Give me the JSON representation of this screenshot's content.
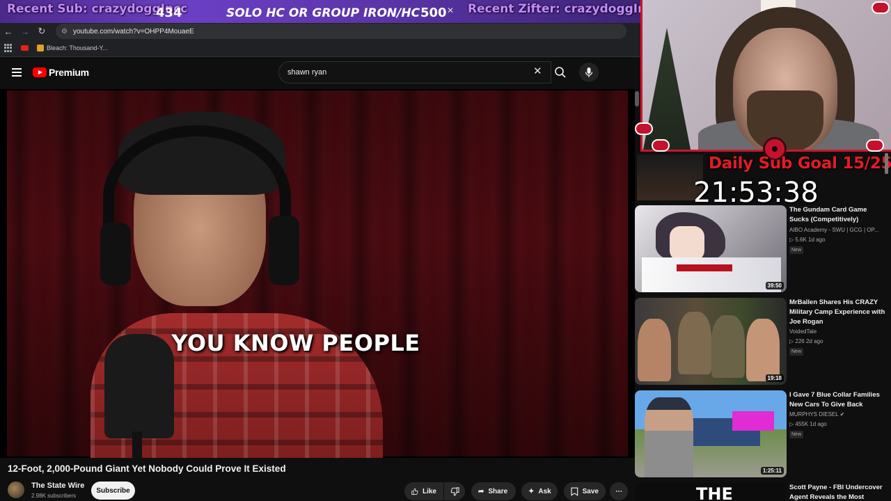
{
  "overlay": {
    "recent_sub": "Recent Sub: crazydoggIncc",
    "count_left": "434",
    "center_text": "SOLO HC OR GROUP IRON/HC",
    "count_right": "500",
    "recent_gifter": "Recent Zifter: crazydoggIncc",
    "daily_goal": "Daily Sub Goal 15/25",
    "timer": "21:53:38"
  },
  "browser": {
    "url": "youtube.com/watch?v=OHPP4MouaeE",
    "bookmark_label": "Bleach: Thousand-Y..."
  },
  "youtube": {
    "logo_text": "Premium",
    "search_value": "shawn ryan",
    "search_placeholder": "Search"
  },
  "video": {
    "caption": "YOU KNOW PEOPLE",
    "title": "12-Foot, 2,000-Pound Giant Yet Nobody Could Prove It Existed",
    "channel": "The State Wire",
    "subscribers": "2.98K subscribers",
    "subscribe_label": "Subscribe",
    "like_label": "Like",
    "share_label": "Share",
    "ask_label": "Ask",
    "save_label": "Save"
  },
  "recommendations": [
    {
      "title": "The Gundam Card Game Sucks (Competitively)",
      "channel": "AIBO Academy - SWU | GCG | OP...",
      "meta": "▷ 5.6K  1d ago",
      "badge": "New",
      "duration": "39:50"
    },
    {
      "title": "MrBallen Shares His CRAZY Military Camp Experience with Joe Rogan",
      "channel": "VoidedTale",
      "meta": "▷ 226  2d ago",
      "badge": "New",
      "duration": "19:18"
    },
    {
      "title": "I Gave 7 Blue Collar Families New Cars To Give Back",
      "channel": "MURPHYS DIESEL ✔",
      "meta": "▷ 455K  1d ago",
      "badge": "New",
      "duration": "1:25:11"
    },
    {
      "title": "Scott Payne - FBI Undercover Agent Reveals the Most",
      "thumb_text": "THE"
    }
  ]
}
